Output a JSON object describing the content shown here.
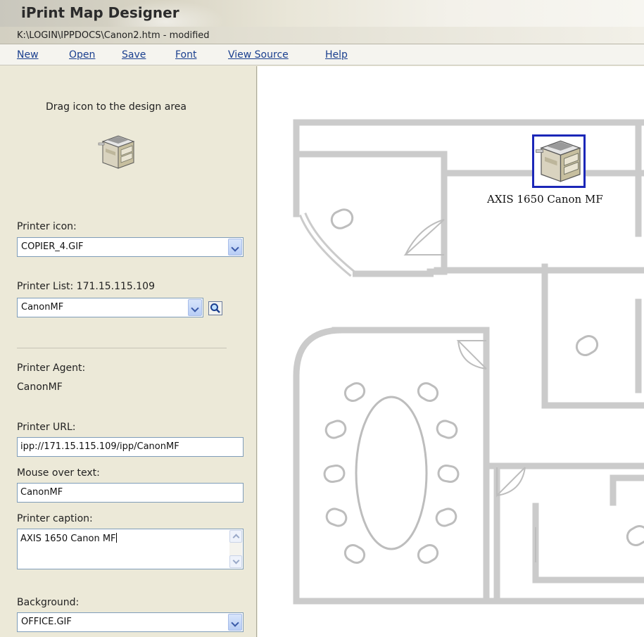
{
  "app": {
    "title": "iPrint Map Designer",
    "file_path": "K:\\LOGIN\\IPPDOCS\\Canon2.htm - modified"
  },
  "menu": {
    "items": [
      {
        "label": "New"
      },
      {
        "label": "Open"
      },
      {
        "label": "Save"
      },
      {
        "label": "Font"
      },
      {
        "label": "View Source"
      },
      {
        "label": "Help"
      }
    ]
  },
  "panel": {
    "drag_hint": "Drag icon to the design area",
    "printer_icon_label": "Printer icon:",
    "printer_icon_value": "COPIER_4.GIF",
    "printer_list_label": "Printer List: 171.15.115.109",
    "printer_list_value": "CanonMF",
    "printer_agent_label": "Printer Agent:",
    "printer_agent_value": "CanonMF",
    "printer_url_label": "Printer URL:",
    "printer_url_value": "ipp://171.15.115.109/ipp/CanonMF",
    "mouse_over_label": "Mouse over text:",
    "mouse_over_value": "CanonMF",
    "caption_label": "Printer caption:",
    "caption_value": "AXIS 1650 Canon MF",
    "background_label": "Background:",
    "background_value": "OFFICE.GIF"
  },
  "design": {
    "printer_caption": "AXIS 1650 Canon MF"
  },
  "icons": {
    "printer": "copier-icon",
    "search": "magnifier-icon",
    "dropdown": "chevron-down-icon"
  },
  "colors": {
    "menu_link": "#1a3f8f",
    "selection_frame": "#1b27b8",
    "panel_bg": "#ece9d8",
    "wall_gray": "#cbcbcb"
  }
}
